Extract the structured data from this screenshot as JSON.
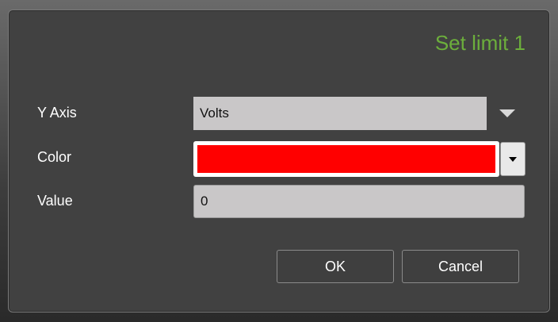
{
  "dialog": {
    "title": "Set limit 1"
  },
  "form": {
    "y_axis_label": "Y Axis",
    "y_axis_value": "Volts",
    "color_label": "Color",
    "color_value": "#ff0000",
    "value_label": "Value",
    "value_value": "0"
  },
  "buttons": {
    "ok_label": "OK",
    "cancel_label": "Cancel"
  },
  "icons": {
    "y_axis_dropdown": "chevron-down-icon",
    "color_dropdown": "chevron-down-icon"
  },
  "colors": {
    "title": "#6cae3c",
    "dialog_bg": "#414141",
    "field_bg": "#c9c7c8",
    "swatch": "#ff0000"
  }
}
